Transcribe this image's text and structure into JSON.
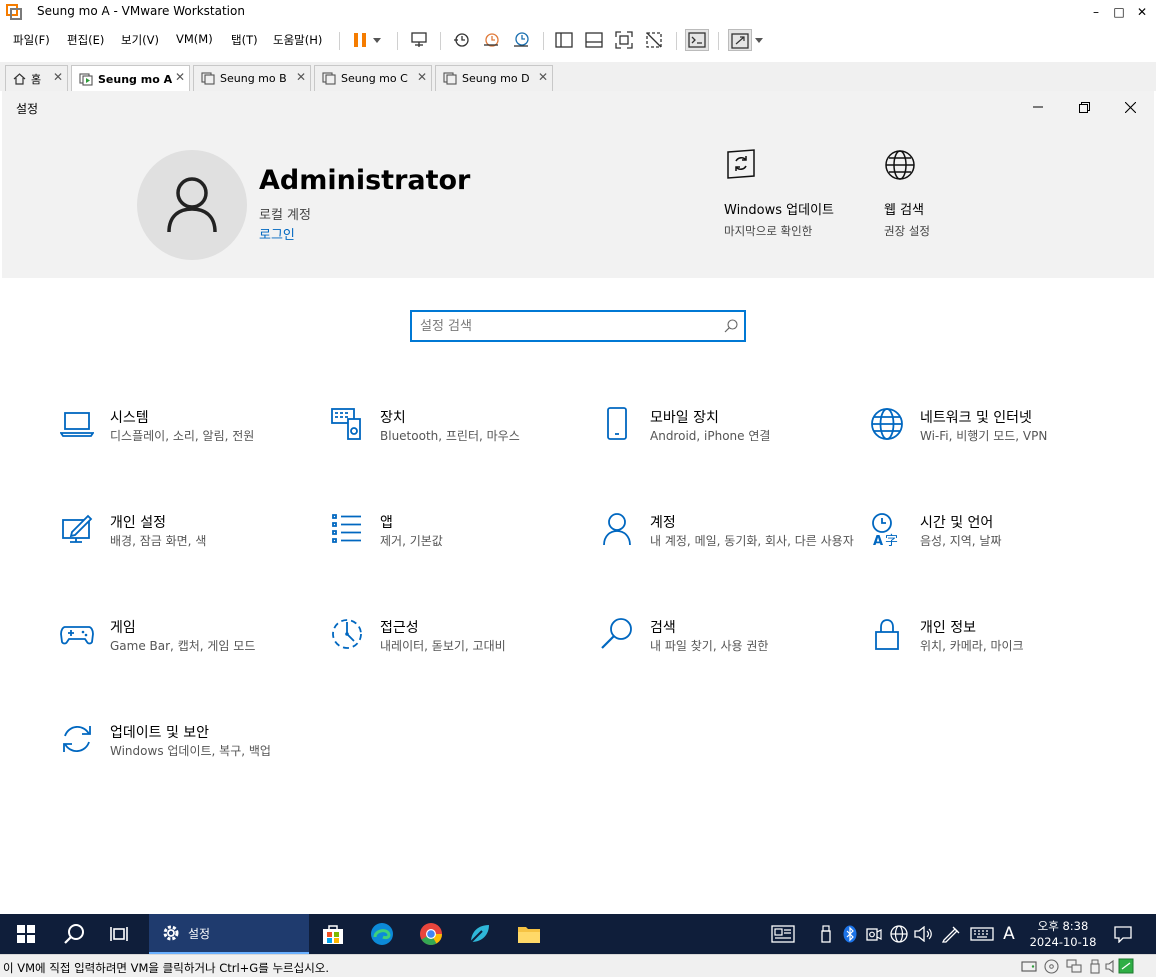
{
  "window": {
    "title": "Seung mo A - VMware Workstation",
    "minimize": "–",
    "maximize": "□",
    "close": "✕",
    "accent_color": "#f57c00"
  },
  "menu": {
    "items": [
      "파일(F)",
      "편집(E)",
      "보기(V)",
      "VM(M)",
      "탭(T)",
      "도움말(H)"
    ]
  },
  "toolbar": {
    "icons": [
      "pause-icon",
      "send-ctrl-alt-del-icon",
      "snapshot-icon",
      "revert-snapshot-icon",
      "snapshot-manager-icon",
      "library-icon",
      "thumbnail-bar-icon",
      "full-screen-icon",
      "unity-icon",
      "console-icon",
      "stretch-icon"
    ]
  },
  "tabs": [
    {
      "label": "홈",
      "active": false
    },
    {
      "label": "Seung mo A",
      "active": true
    },
    {
      "label": "Seung mo B",
      "active": false
    },
    {
      "label": "Seung mo C",
      "active": false
    },
    {
      "label": "Seung mo D",
      "active": false
    }
  ],
  "settings": {
    "title": "설정",
    "account": {
      "name": "Administrator",
      "type": "로컬 계정",
      "signin": "로그인"
    },
    "quick": [
      {
        "title": "Windows 업데이트",
        "sub": "마지막으로 확인한"
      },
      {
        "title": "웹 검색",
        "sub": "권장 설정"
      }
    ],
    "search_placeholder": "설정 검색",
    "categories": [
      {
        "title": "시스템",
        "sub": "디스플레이, 소리, 알림, 전원",
        "icon": "laptop-icon"
      },
      {
        "title": "장치",
        "sub": "Bluetooth, 프린터, 마우스",
        "icon": "devices-icon"
      },
      {
        "title": "모바일 장치",
        "sub": "Android, iPhone 연결",
        "icon": "phone-icon"
      },
      {
        "title": "네트워크 및 인터넷",
        "sub": "Wi-Fi, 비행기 모드, VPN",
        "icon": "globe-icon"
      },
      {
        "title": "개인 설정",
        "sub": "배경, 잠금 화면, 색",
        "icon": "personalization-icon"
      },
      {
        "title": "앱",
        "sub": "제거, 기본값",
        "icon": "apps-list-icon"
      },
      {
        "title": "계정",
        "sub": "내 계정, 메일, 동기화, 회사, 다른 사용자",
        "icon": "person-icon"
      },
      {
        "title": "시간 및 언어",
        "sub": "음성, 지역, 날짜",
        "icon": "time-language-icon"
      },
      {
        "title": "게임",
        "sub": "Game Bar, 캡처, 게임 모드",
        "icon": "gamepad-icon"
      },
      {
        "title": "접근성",
        "sub": "내레이터, 돋보기, 고대비",
        "icon": "accessibility-icon"
      },
      {
        "title": "검색",
        "sub": "내 파일 찾기, 사용 권한",
        "icon": "search-icon"
      },
      {
        "title": "개인 정보",
        "sub": "위치, 카메라, 마이크",
        "icon": "lock-icon"
      },
      {
        "title": "업데이트 및 보안",
        "sub": "Windows 업데이트, 복구, 백업",
        "icon": "sync-icon"
      }
    ]
  },
  "taskbar": {
    "active_app": "설정",
    "ime": "A",
    "time": "오후 8:38",
    "date": "2024-10-18"
  },
  "status": {
    "text": "이 VM에 직접 입력하려면 VM을 클릭하거나 Ctrl+G를 누르십시오."
  }
}
